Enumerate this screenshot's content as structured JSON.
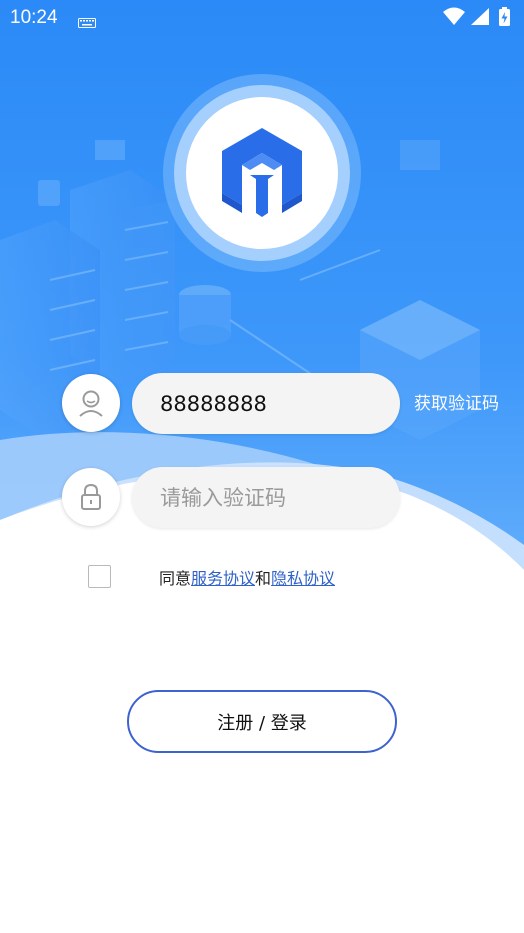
{
  "status_bar": {
    "time": "10:24",
    "icons": [
      "keyboard-icon",
      "wifi-icon",
      "signal-icon",
      "battery-icon"
    ]
  },
  "login_form": {
    "phone": {
      "value": "88888888",
      "placeholder": ""
    },
    "get_code_label": "获取验证码",
    "code": {
      "value": "",
      "placeholder": "请输入验证码"
    }
  },
  "agreement": {
    "prefix": "同意",
    "service_link": "服务协议",
    "conjunction": "和",
    "privacy_link": "隐私协议",
    "checked": false
  },
  "submit_label": "注册 / 登录",
  "colors": {
    "primary_blue": "#2b87f5",
    "accent_button_border": "#3e62cf",
    "link": "#2f62c9",
    "logo_blue": "#2a6de8"
  }
}
